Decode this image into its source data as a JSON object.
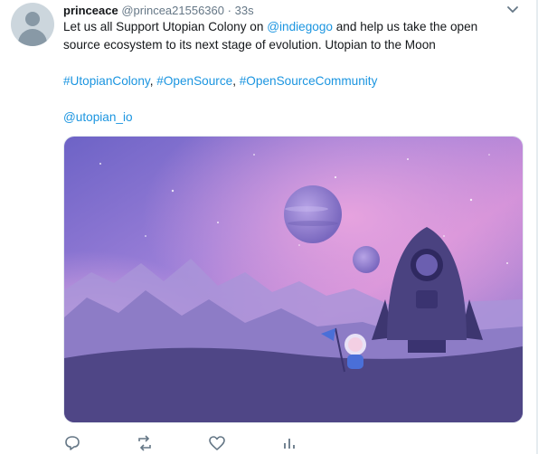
{
  "tweet": {
    "author": {
      "name": "princeace",
      "handle": "@princea21556360"
    },
    "separator": "·",
    "timestamp": "33s",
    "text": {
      "line1_prefix": "Let us all Support Utopian Colony on ",
      "mention1": "@indiegogo",
      "line1_suffix": " and help us take the open source ecosystem to its next stage of evolution. Utopian to the Moon",
      "hashtags": [
        "#UtopianColony",
        "#OpenSource",
        "#OpenSourceCommunity"
      ],
      "hashtag_separator": ", ",
      "mention2": "@utopian_io"
    },
    "media": {
      "alt": ""
    },
    "actions": {
      "reply_icon": "reply-icon",
      "retweet_icon": "retweet-icon",
      "like_icon": "heart-icon",
      "analytics_icon": "analytics-icon"
    },
    "colors": {
      "link": "#1b95e0",
      "text": "#14171a",
      "muted": "#657786"
    }
  }
}
